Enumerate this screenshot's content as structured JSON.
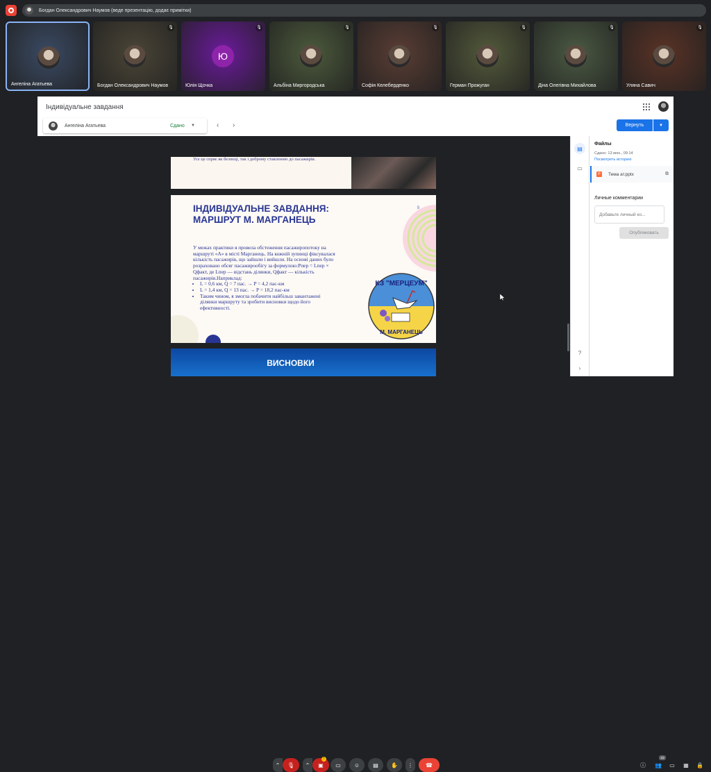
{
  "meet": {
    "presenting_label": "Богдан Олександрович Наумов (веде презентацію, додає примітки)",
    "participants": [
      {
        "name": "Ангеліна Агатьева",
        "bg": "#3a4a63",
        "mic": "",
        "active": true
      },
      {
        "name": "Богдан Олександрович Наумов",
        "bg": "#4a4537",
        "mic": "🎙"
      },
      {
        "name": "Юлія Щочка",
        "bg": "#6a1b9a",
        "mic": "🎙",
        "initial": "Ю"
      },
      {
        "name": "Альбіна Миргородська",
        "bg": "#4c5a3c",
        "mic": "🎙"
      },
      {
        "name": "Софія Келеберденко",
        "bg": "#5a3d34",
        "mic": "🎙"
      },
      {
        "name": "Герман Прожуган",
        "bg": "#535a3b",
        "mic": "🎙"
      },
      {
        "name": "Діна Олегівна Михайлова",
        "bg": "#4b5a43",
        "mic": "🎙"
      },
      {
        "name": "Уляна Савич",
        "bg": "#5a3326",
        "mic": "🎙"
      }
    ],
    "people_count": "10"
  },
  "classroom": {
    "title": "Індивідуальне завдання",
    "student_name": "Ангеліна Агатьева",
    "status": "Сдано",
    "return_label": "Вернуть",
    "files_title": "Файлы",
    "files_date": "Сдано: 13 июн., 09:14",
    "files_history": "Посмотреть историю",
    "file_name": "Тема ат.pptx",
    "comments_title": "Личные комментарии",
    "comment_placeholder": "Добавьте личный ко...",
    "publish_label": "Опубликовать"
  },
  "slides": {
    "s1_text": "Усе це спряє як безпеці, так і доброму ставленню до пасажирів.",
    "s2_heading": "ІНДИВІДУАЛЬНЕ ЗАВДАННЯ: МАРШРУТ М. МАРГАНЕЦЬ",
    "s2_page": "9",
    "s2_body": "У межах практики я провела обстеження пасажиропотоку на маршруті «А» в місті Марганець. На кожній зупинці фіксувалася кількість пасажирів, що зайшли і вийшли. На основі даних було розраховано обсяг пасажирообігу за формулою:Pпер = Lпер × Qфакт, де Lпер — відстань ділянки, Qфакт — кількість пасажирів.Наприклад:",
    "s2_items": [
      "L = 0,6 км, Q = 7 пас. → P = 4,2 пас-км",
      "L = 1,4 км, Q = 13 пас. → P = 18,2 пас-км",
      "Таким чином, я змогла побачити найбільш завантажені ділянки маршруту та зробити висновки щодо його ефективності."
    ],
    "emblem_top": "КЗ \"МЕРЦЕУМ\"",
    "emblem_bottom": "М. МАРГАНЕЦЬ",
    "s3_title": "ВИСНОВКИ"
  },
  "colors": {
    "accent": "#1a73e8",
    "end_call": "#ea4335",
    "muted": "#c5221f"
  }
}
